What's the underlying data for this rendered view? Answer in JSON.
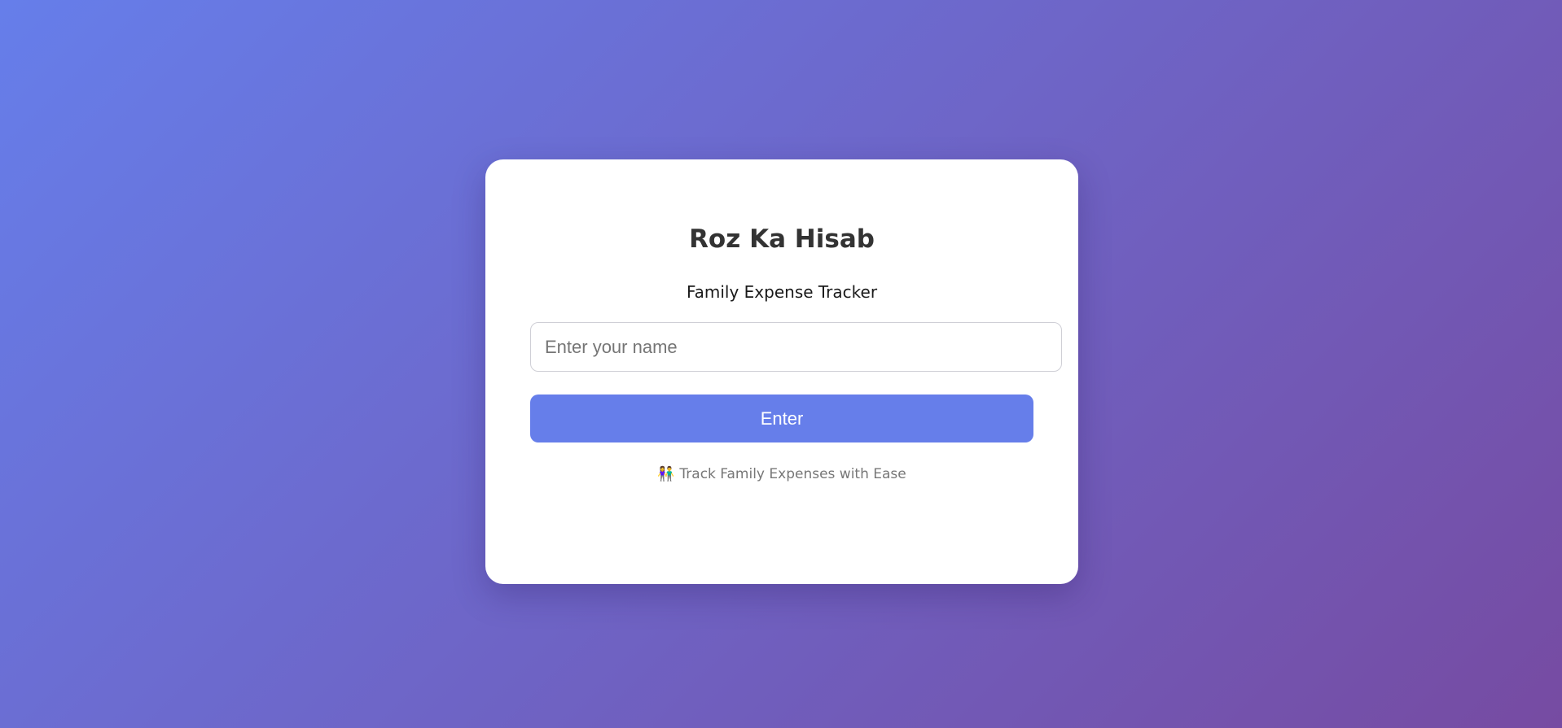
{
  "app": {
    "title": "Roz Ka Hisab",
    "subtitle": "Family Expense Tracker"
  },
  "login_form": {
    "name_input": {
      "value": "",
      "placeholder": "Enter your name"
    },
    "enter_button_label": "Enter"
  },
  "footer": {
    "icon": "family-icon",
    "icon_glyph": "👫",
    "tagline": "Track Family Expenses with Ease"
  },
  "colors": {
    "background_gradient_start": "#667eea",
    "background_gradient_end": "#764ba2",
    "button": "#667eea",
    "card": "#ffffff",
    "title_text": "#333333",
    "tagline_text": "#777777"
  }
}
